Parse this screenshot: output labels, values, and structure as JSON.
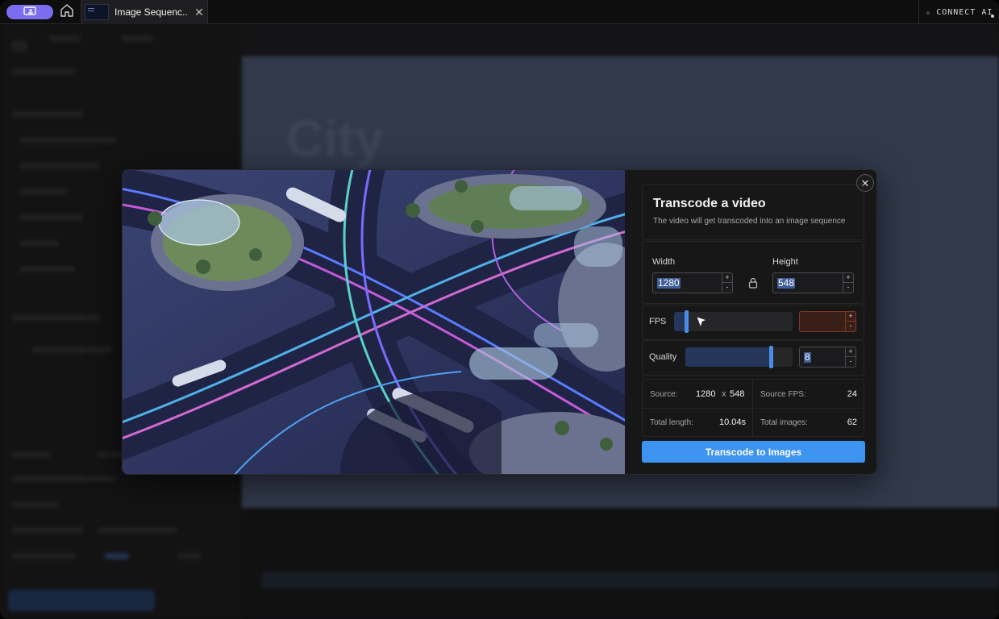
{
  "tab": {
    "title": "Image Sequenc...",
    "close": "✕"
  },
  "connect": {
    "label": "CONNECT AI"
  },
  "modal": {
    "title": "Transcode a video",
    "subtitle": "The video will get transcoded into an image sequence",
    "close": "✕",
    "width": {
      "label": "Width",
      "value": "1280"
    },
    "height": {
      "label": "Height",
      "value": "548"
    },
    "fps": {
      "label": "FPS",
      "value": "",
      "level": 0.1
    },
    "quality": {
      "label": "Quality",
      "value": "8",
      "level": 0.8
    },
    "stepper_up": "+",
    "stepper_down": "-",
    "stats": {
      "source_label": "Source:",
      "source_w": "1280",
      "source_x": "x",
      "source_h": "548",
      "source_fps_label": "Source FPS:",
      "source_fps": "24",
      "total_length_label": "Total length:",
      "total_length": "10.04s",
      "total_images_label": "Total images:",
      "total_images": "62"
    },
    "submit_label": "Transcode to Images"
  },
  "colors": {
    "accent": "#3d93f0",
    "app_pill": "#7b6cf0",
    "fps_error": "#3a1f18"
  },
  "icons": [
    "app-icon",
    "home-icon",
    "sparkle-icon",
    "lock-icon",
    "close-icon",
    "cursor-icon"
  ]
}
